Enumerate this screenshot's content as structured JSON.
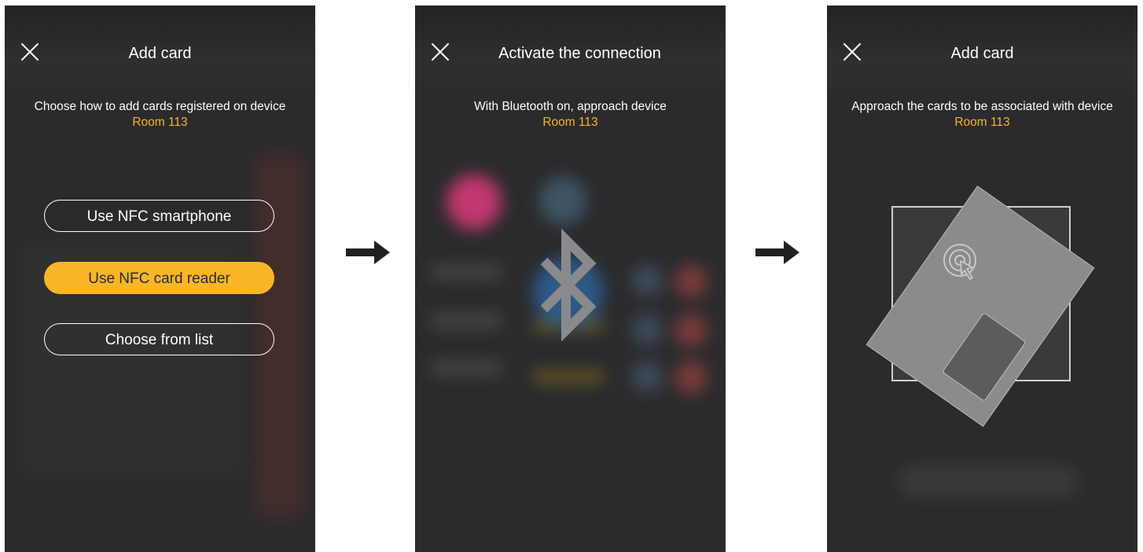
{
  "screens": [
    {
      "title": "Add card",
      "description": "Choose how to add cards registered on device",
      "device_name": "Room 113",
      "buttons": [
        {
          "label": "Use NFC smartphone",
          "style": "outline"
        },
        {
          "label": "Use NFC card reader",
          "style": "filled"
        },
        {
          "label": "Choose from list",
          "style": "outline"
        }
      ]
    },
    {
      "title": "Activate the connection",
      "description": "With Bluetooth on, approach device",
      "device_name": "Room 113",
      "icon": "bluetooth-icon"
    },
    {
      "title": "Add card",
      "description": "Approach the cards to be associated with device",
      "device_name": "Room 113",
      "icons": [
        "nfc-card-icon",
        "card-reader-icon",
        "bluetooth-icon"
      ]
    }
  ],
  "colors": {
    "accent": "#f9b526",
    "background": "#2b2b2d",
    "text": "#ffffff",
    "card": "#8a8a8a"
  },
  "arrows": [
    "right-arrow-icon",
    "right-arrow-icon"
  ]
}
